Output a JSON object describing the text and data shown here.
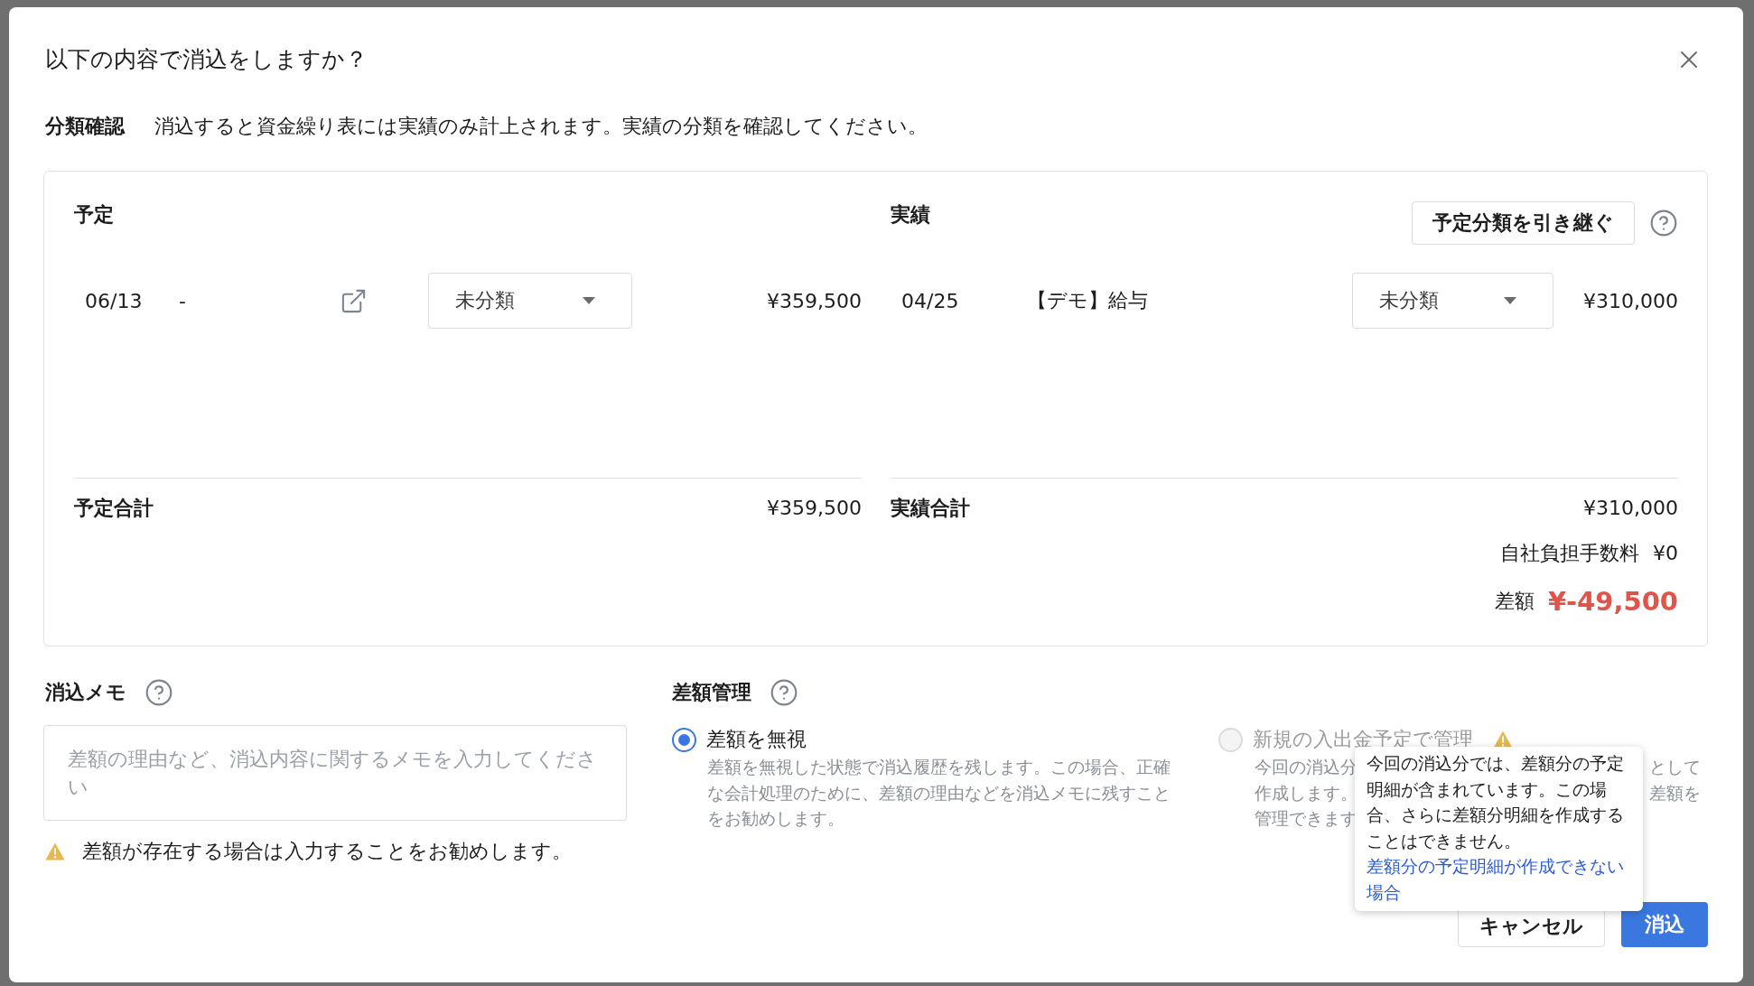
{
  "dialog": {
    "title": "以下の内容で消込をしますか？"
  },
  "classification": {
    "label": "分類確認",
    "message": "消込すると資金繰り表には実績のみ計上されます。実績の分類を確認してください。"
  },
  "plan": {
    "heading": "予定",
    "rows": [
      {
        "date": "06/13",
        "description": "-",
        "category": "未分類",
        "amount": "¥359,500"
      }
    ],
    "total_label": "予定合計",
    "total": "¥359,500"
  },
  "actual": {
    "heading": "実績",
    "inherit_button": "予定分類を引き継ぐ",
    "rows": [
      {
        "date": "04/25",
        "description": "【デモ】給与",
        "category": "未分類",
        "amount": "¥310,000"
      }
    ],
    "total_label": "実績合計",
    "total": "¥310,000",
    "fee_label": "自社負担手数料",
    "fee": "¥0",
    "difference_label": "差額",
    "difference": "¥-49,500"
  },
  "memo": {
    "heading": "消込メモ",
    "placeholder": "差額の理由など、消込内容に関するメモを入力してください",
    "warning": "差額が存在する場合は入力することをお勧めします。"
  },
  "difference_management": {
    "heading": "差額管理",
    "options": [
      {
        "label": "差額を無視",
        "selected": true,
        "disabled": false,
        "warning": false,
        "description": "差額を無視した状態で消込履歴を残します。この場合、正確な会計処理のために、差額の理由などを消込メモに残すことをお勧めします。"
      },
      {
        "label": "新規の入出金予定で管理",
        "selected": false,
        "disabled": true,
        "warning": true,
        "description_fragments": [
          {
            "left": "今回の消込分",
            "right": "として"
          },
          {
            "left": "作成します。",
            "right": "差額を"
          },
          {
            "left": "管理できます"
          }
        ]
      }
    ]
  },
  "tooltip": {
    "text": "今回の消込分では、差額分の予定明細が含まれています。この場合、さらに差額分明細を作成することはできません。",
    "link": "差額分の予定明細が作成できない場合"
  },
  "buttons": {
    "cancel": "キャンセル",
    "confirm": "消込"
  }
}
